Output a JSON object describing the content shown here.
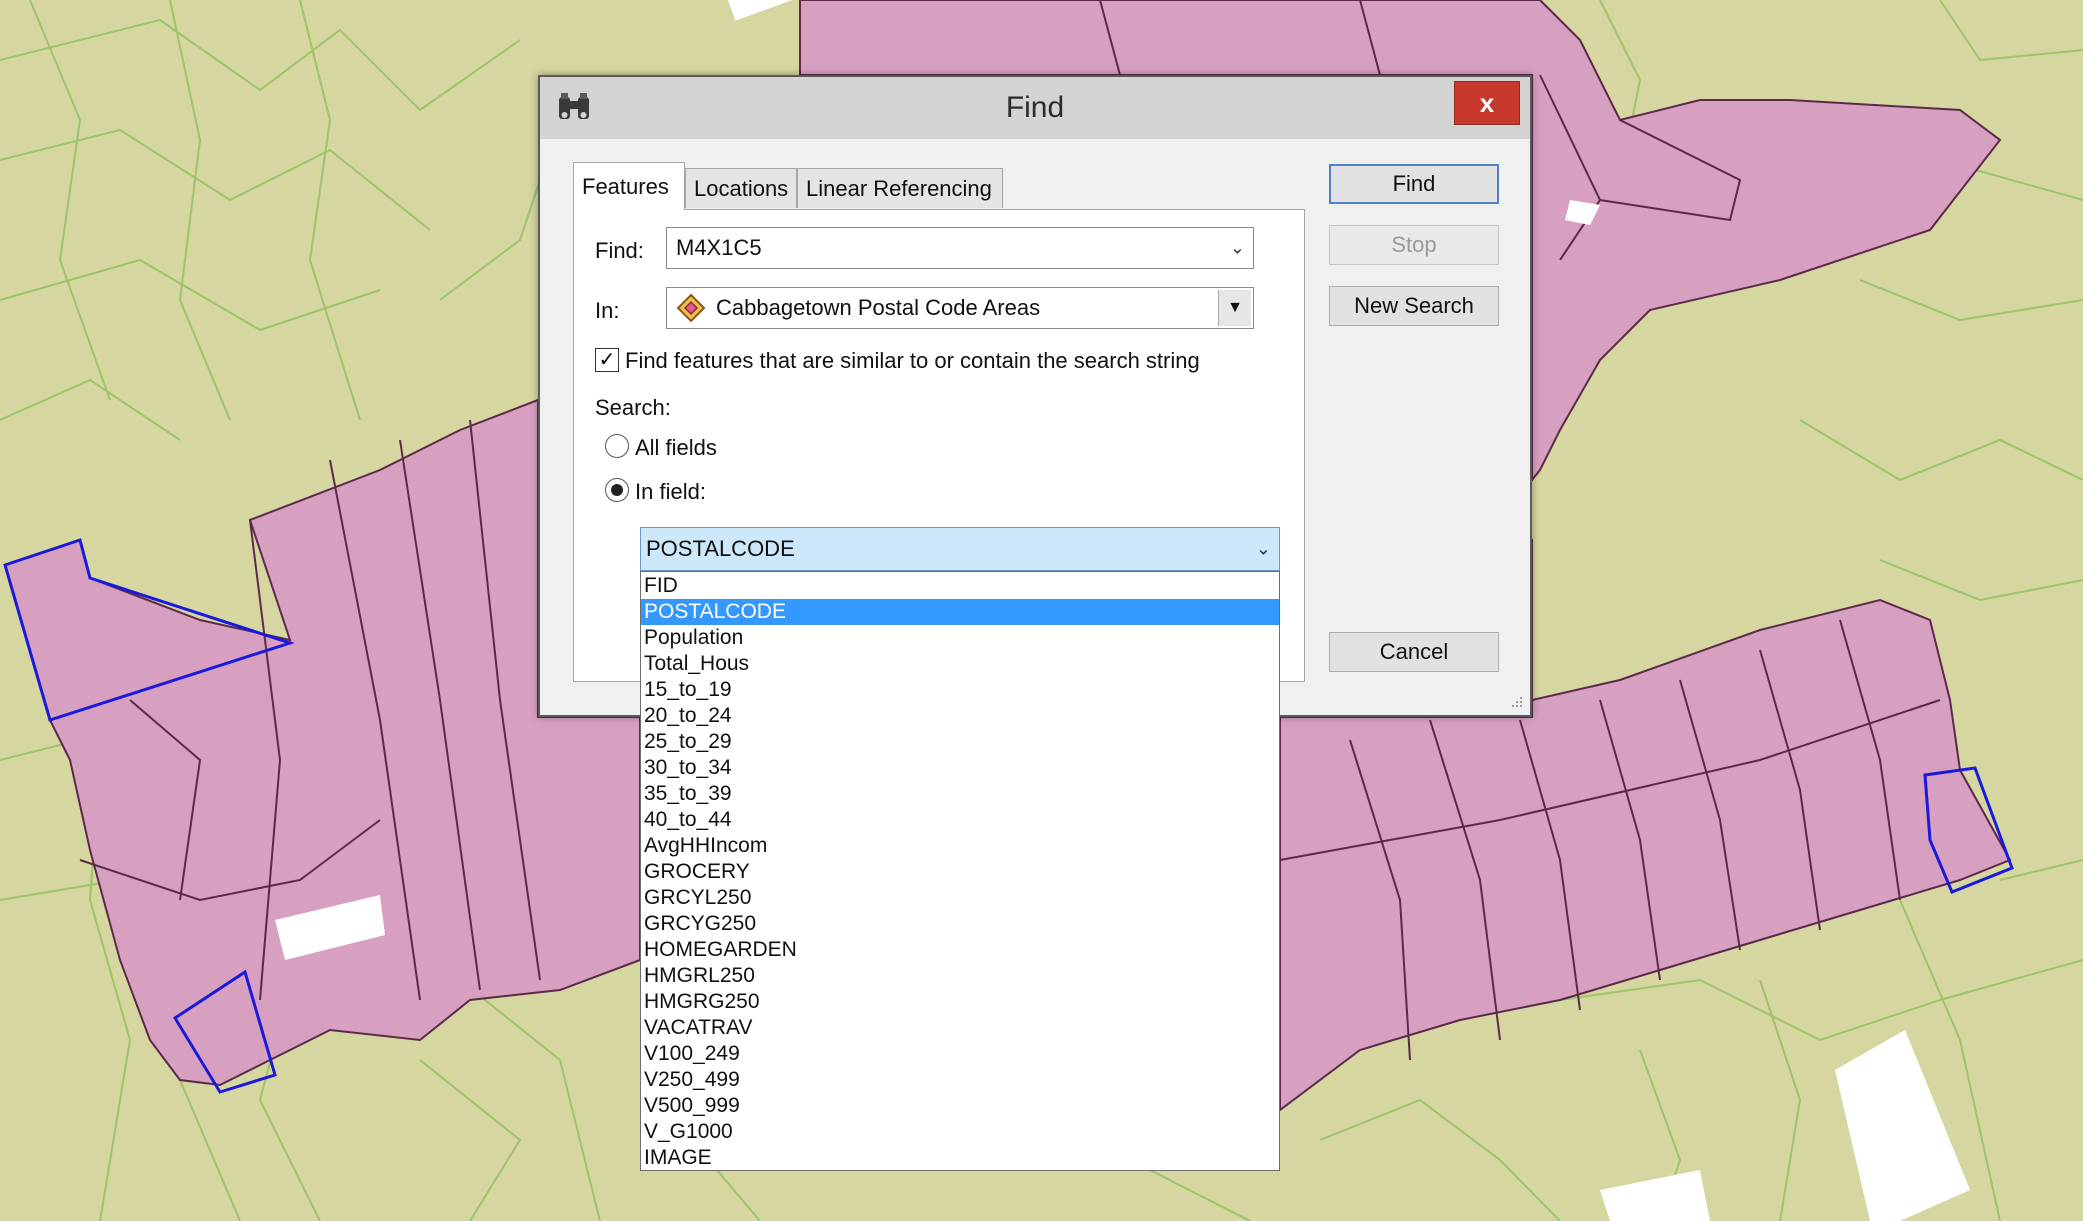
{
  "dialog": {
    "title": "Find",
    "close_label": "x",
    "tabs": [
      "Features",
      "Locations",
      "Linear Referencing"
    ],
    "find_label": "Find:",
    "find_value": "M4X1C5",
    "in_label": "In:",
    "in_value": "Cabbagetown Postal Code Areas",
    "similar_checkbox_label": "Find features that are similar to or contain the search string",
    "similar_checked": true,
    "search_label": "Search:",
    "all_fields_label": "All fields",
    "in_field_label": "In field:",
    "selected_field": "POSTALCODE",
    "buttons": {
      "find": "Find",
      "stop": "Stop",
      "new_search": "New Search",
      "cancel": "Cancel"
    }
  },
  "field_options": [
    "FID",
    "POSTALCODE",
    "Population",
    "Total_Hous",
    "15_to_19",
    "20_to_24",
    "25_to_29",
    "30_to_34",
    "35_to_39",
    "40_to_44",
    "AvgHHIncom",
    "GROCERY",
    "GRCYL250",
    "GRCYG250",
    "HOMEGARDEN",
    "HMGRL250",
    "HMGRG250",
    "VACATRAV",
    "V100_249",
    "V250_499",
    "V500_999",
    "V_G1000",
    "IMAGE"
  ],
  "selected_field_index": 1,
  "colors": {
    "map_background": "#d6d6a0",
    "postal_area_fill": "#d8a0c0",
    "postal_area_stroke": "#5b2a4a",
    "street_line": "#9cc46a",
    "selected_outline": "#1a1adc",
    "list_selection": "#3399ff"
  }
}
